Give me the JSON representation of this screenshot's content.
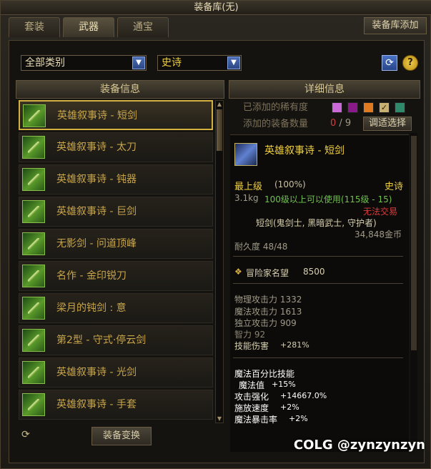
{
  "window": {
    "title": "装备库(无)"
  },
  "tabs": [
    {
      "label": "套装",
      "active": false
    },
    {
      "label": "武器",
      "active": true
    },
    {
      "label": "通宝",
      "active": false
    }
  ],
  "top_right_button": "装备库添加",
  "filters": {
    "category": "全部类别",
    "rarity": "史诗"
  },
  "left_panel": {
    "header": "装备信息",
    "items": [
      {
        "label": "英雄叙事诗 - 短剑",
        "selected": true
      },
      {
        "label": "英雄叙事诗 - 太刀",
        "selected": false
      },
      {
        "label": "英雄叙事诗 - 钝器",
        "selected": false
      },
      {
        "label": "英雄叙事诗 - 巨剑",
        "selected": false
      },
      {
        "label": "无影剑 - 问道顶峰",
        "selected": false
      },
      {
        "label": "名作 - 金印锐刀",
        "selected": false
      },
      {
        "label": "梁月的钝剑 : 意",
        "selected": false
      },
      {
        "label": "第2型 - 守式·停云剑",
        "selected": false
      },
      {
        "label": "英雄叙事诗 - 光剑",
        "selected": false
      },
      {
        "label": "英雄叙事诗 - 手套",
        "selected": false
      }
    ],
    "transform_button": "装备变换"
  },
  "right_panel": {
    "header": "详细信息",
    "added_rarity_label": "已添加的稀有度",
    "rarity_swatches": [
      "#c96ad8",
      "#8a1a8a",
      "#e07a20",
      "#c8b070",
      "#2e8a6a"
    ],
    "added_count_label": "添加的装备数量",
    "added_count": "0",
    "added_total": "/ 9",
    "adjust_button": "调适选择",
    "detail": {
      "name": "英雄叙事诗 - 短剑",
      "grade": "最上级",
      "grade_pct": "(100%)",
      "rarity": "史诗",
      "weight": "3.1kg",
      "level_req": "100级以上可以使用(115级 - 15)",
      "trade": "无法交易",
      "classes": "短剑(鬼剑士, 黑暗武士, 守护者)",
      "price": "34,848金币",
      "durability": "耐久度 48/48",
      "fame_label": "冒险家名望",
      "fame_value": "8500",
      "stats": [
        "物理攻击力 1332",
        "魔法攻击力 1613",
        "独立攻击力 909",
        "智力 92"
      ],
      "skill_damage_label": "技能伤害",
      "skill_damage_value": "+281%",
      "special_title": "魔法百分比技能",
      "special_magic": "魔法值",
      "special_magic_val": "+15%",
      "attack_boost": "攻击强化",
      "attack_boost_val": "+14667.0%",
      "cast_speed": "施放速度",
      "cast_speed_val": "+2%",
      "crit": "魔法暴击率",
      "crit_val": "+2%"
    }
  },
  "watermark": "COLG @zynzynzyn"
}
